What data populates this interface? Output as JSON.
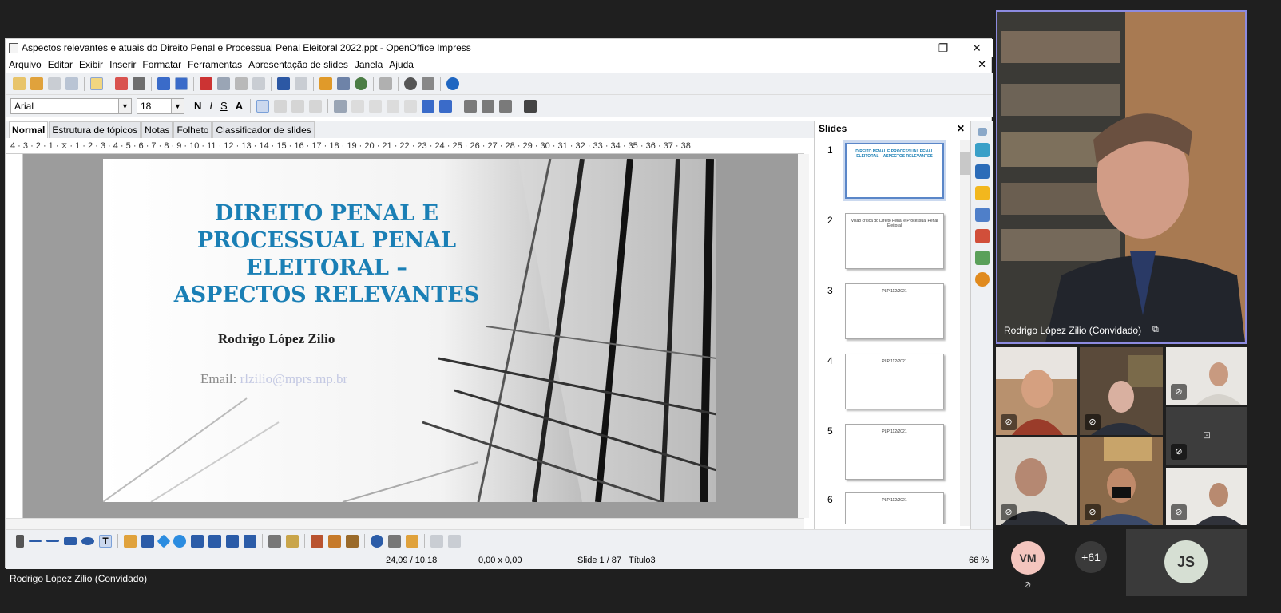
{
  "window": {
    "title": "Aspectos relevantes e atuais do Direito Penal e Processual Penal Eleitoral 2022.ppt - OpenOffice Impress",
    "minimize": "–",
    "maximize": "❐",
    "close": "✕",
    "doc_close": "✕"
  },
  "menu": [
    "Arquivo",
    "Editar",
    "Exibir",
    "Inserir",
    "Formatar",
    "Ferramentas",
    "Apresentação de slides",
    "Janela",
    "Ajuda"
  ],
  "format": {
    "font": "Arial",
    "size": "18",
    "bold": "N",
    "italic": "I",
    "underline": "S",
    "shadow": "A"
  },
  "view_tabs": [
    "Normal",
    "Estrutura de tópicos",
    "Notas",
    "Folheto",
    "Classificador de slides"
  ],
  "ruler_text": "4 · 3 · 2 · 1 · ⧖ · 1 · 2 · 3 · 4 · 5 · 6 · 7 · 8 · 9 · 10 · 11 · 12 · 13 · 14 · 15 · 16 · 17 · 18 · 19 · 20 · 21 · 22 · 23 · 24 · 25 · 26 · 27 · 28 · 29 · 30 · 31 · 32 · 33 · 34 · 35 · 36 · 37 · 38",
  "slide": {
    "title_lines": [
      "DIREITO PENAL E",
      "PROCESSUAL PENAL",
      "ELEITORAL –",
      "ASPECTOS RELEVANTES"
    ],
    "author": "Rodrigo López Zilio",
    "email_label": "Email: ",
    "email": "rlzilio@mprs.mp.br"
  },
  "slides_pane": {
    "title": "Slides",
    "close": "✕",
    "thumbs": [
      {
        "num": "1",
        "text": "DIREITO PENAL E PROCESSUAL PENAL ELEITORAL – ASPECTOS RELEVANTES"
      },
      {
        "num": "2",
        "text": "Visão crítica do Direito Penal e Processual Penal Eleitoral"
      },
      {
        "num": "3",
        "text": "PLP 112/2021"
      },
      {
        "num": "4",
        "text": "PLP 112/2021"
      },
      {
        "num": "5",
        "text": "PLP 112/2021"
      },
      {
        "num": "6",
        "text": "PLP 112/2021"
      }
    ]
  },
  "status": {
    "position": "24,09 / 10,18",
    "size": "0,00 x 0,00",
    "slide": "Slide 1 / 87",
    "layout": "Título3",
    "zoom": "66 %"
  },
  "presenter_label": "Rodrigo López Zilio (Convidado)",
  "speaker_label": "Rodrigo López Zilio (Convidado)",
  "speaker_icon": "screen-share-icon",
  "participants": {
    "overflow": "+61",
    "vm": "VM",
    "js": "JS"
  },
  "colors": {
    "accent": "#8d8be0",
    "title_blue": "#1a7fb5"
  }
}
